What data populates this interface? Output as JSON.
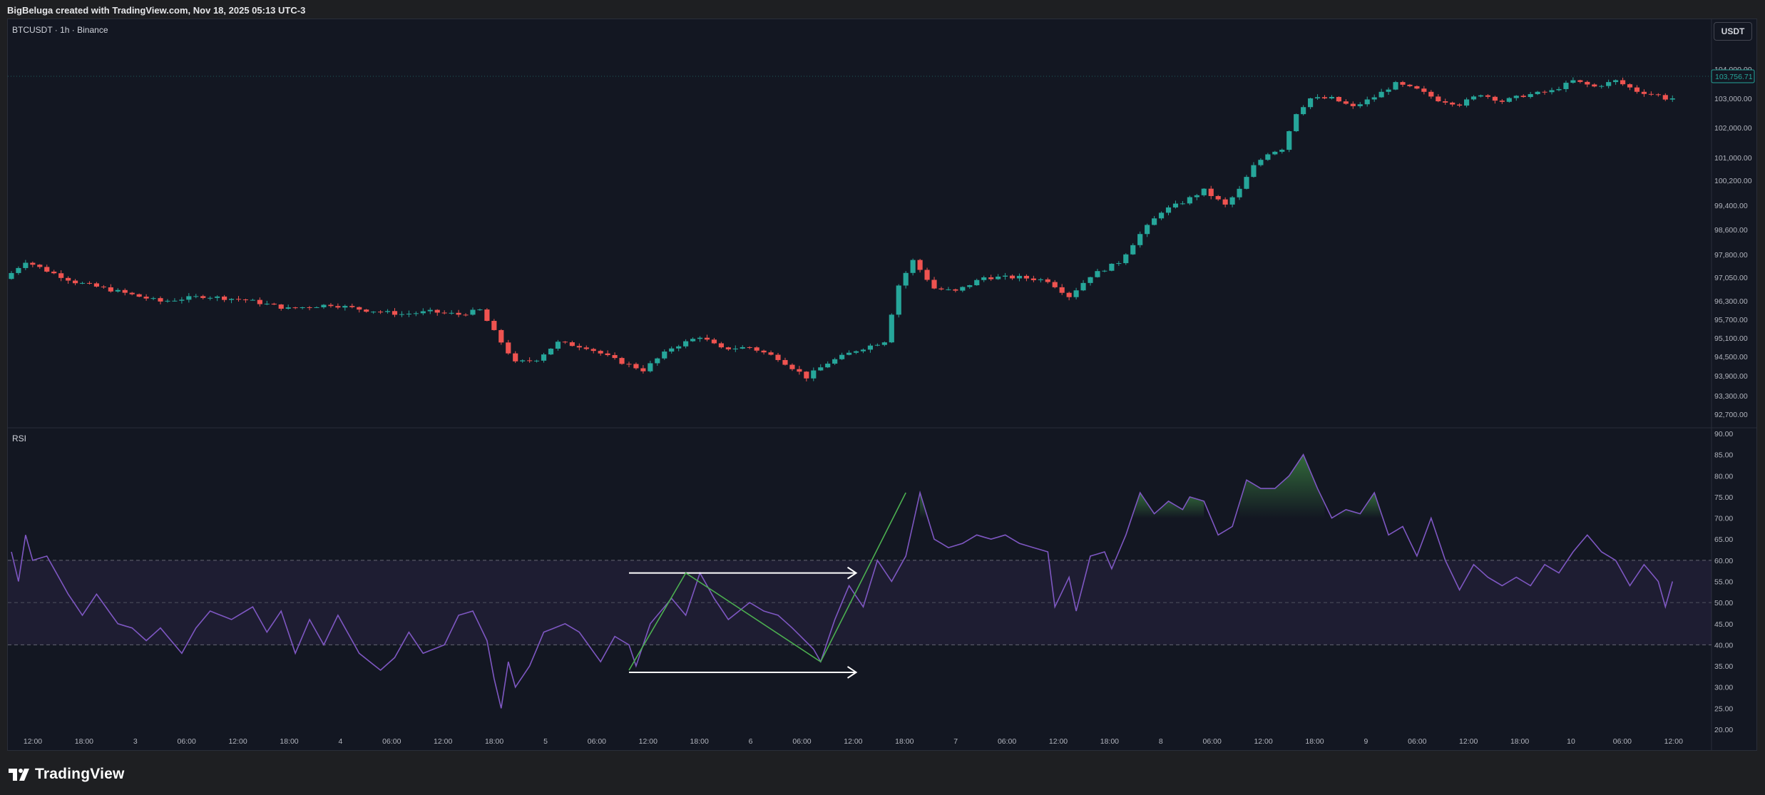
{
  "header": {
    "text": "BigBeluga created with TradingView.com, Nov 18, 2025 05:13 UTC-3"
  },
  "legend": {
    "symbol_text": "BTCUSDT · 1h · Binance"
  },
  "currency_button": {
    "label": "USDT"
  },
  "rsi_panel": {
    "label": "RSI"
  },
  "price_tag": {
    "value": "103,756.71"
  },
  "brand": {
    "name": "TradingView"
  },
  "colors": {
    "up": "#26a69a",
    "down": "#ef5350",
    "rsi": "#7e57c2",
    "arrows": "#ffffff",
    "divergence": "#4caf50",
    "background": "#131722"
  },
  "chart_data": [
    {
      "type": "candlestick",
      "symbol": "BTCUSDT",
      "interval": "1h",
      "exchange": "Binance",
      "ylim": [
        92300,
        104300
      ],
      "y_ticks": [
        "104,000.00",
        "103,000.00",
        "102,000.00",
        "101,000.00",
        "100,200.00",
        "99,400.00",
        "98,600.00",
        "97,800.00",
        "97,050.00",
        "96,300.00",
        "95,700.00",
        "95,100.00",
        "94,500.00",
        "93,900.00",
        "93,300.00",
        "92,700.00"
      ],
      "x_ticks": [
        "12:00",
        "18:00",
        "3",
        "06:00",
        "12:00",
        "18:00",
        "4",
        "06:00",
        "12:00",
        "18:00",
        "5",
        "06:00",
        "12:00",
        "18:00",
        "6",
        "06:00",
        "12:00",
        "18:00",
        "7",
        "06:00",
        "12:00",
        "18:00",
        "8",
        "06:00",
        "12:00",
        "18:00",
        "9",
        "06:00",
        "12:00",
        "18:00",
        "10",
        "06:00",
        "12:00"
      ],
      "waypoints": [
        {
          "i": 0,
          "v": 97000
        },
        {
          "i": 3,
          "v": 97580
        },
        {
          "i": 6,
          "v": 97270
        },
        {
          "i": 10,
          "v": 96900
        },
        {
          "i": 16,
          "v": 96600
        },
        {
          "i": 22,
          "v": 96280
        },
        {
          "i": 28,
          "v": 96450
        },
        {
          "i": 34,
          "v": 96330
        },
        {
          "i": 40,
          "v": 96050
        },
        {
          "i": 46,
          "v": 96180
        },
        {
          "i": 51,
          "v": 96000
        },
        {
          "i": 56,
          "v": 95870
        },
        {
          "i": 60,
          "v": 95950
        },
        {
          "i": 64,
          "v": 95860
        },
        {
          "i": 67,
          "v": 96000
        },
        {
          "i": 69,
          "v": 95300
        },
        {
          "i": 72,
          "v": 94300
        },
        {
          "i": 75,
          "v": 94420
        },
        {
          "i": 78,
          "v": 94950
        },
        {
          "i": 82,
          "v": 94800
        },
        {
          "i": 86,
          "v": 94400
        },
        {
          "i": 90,
          "v": 94080
        },
        {
          "i": 94,
          "v": 94780
        },
        {
          "i": 98,
          "v": 95150
        },
        {
          "i": 101,
          "v": 94750
        },
        {
          "i": 105,
          "v": 94800
        },
        {
          "i": 109,
          "v": 94450
        },
        {
          "i": 113,
          "v": 93860
        },
        {
          "i": 116,
          "v": 94300
        },
        {
          "i": 120,
          "v": 94700
        },
        {
          "i": 124,
          "v": 95000
        },
        {
          "i": 126,
          "v": 96800
        },
        {
          "i": 128,
          "v": 97600
        },
        {
          "i": 131,
          "v": 96700
        },
        {
          "i": 134,
          "v": 96600
        },
        {
          "i": 138,
          "v": 97050
        },
        {
          "i": 143,
          "v": 97050
        },
        {
          "i": 147,
          "v": 96950
        },
        {
          "i": 150,
          "v": 96450
        },
        {
          "i": 153,
          "v": 97100
        },
        {
          "i": 157,
          "v": 97550
        },
        {
          "i": 160,
          "v": 98450
        },
        {
          "i": 163,
          "v": 99200
        },
        {
          "i": 166,
          "v": 99500
        },
        {
          "i": 169,
          "v": 99880
        },
        {
          "i": 172,
          "v": 99400
        },
        {
          "i": 174,
          "v": 99900
        },
        {
          "i": 176,
          "v": 100700
        },
        {
          "i": 178,
          "v": 101150
        },
        {
          "i": 180,
          "v": 101300
        },
        {
          "i": 182,
          "v": 102500
        },
        {
          "i": 184,
          "v": 103000
        },
        {
          "i": 187,
          "v": 103000
        },
        {
          "i": 190,
          "v": 102700
        },
        {
          "i": 193,
          "v": 103050
        },
        {
          "i": 196,
          "v": 103500
        },
        {
          "i": 199,
          "v": 103300
        },
        {
          "i": 202,
          "v": 102950
        },
        {
          "i": 205,
          "v": 102800
        },
        {
          "i": 208,
          "v": 103150
        },
        {
          "i": 211,
          "v": 102900
        },
        {
          "i": 214,
          "v": 103100
        },
        {
          "i": 218,
          "v": 103250
        },
        {
          "i": 221,
          "v": 103600
        },
        {
          "i": 224,
          "v": 103400
        },
        {
          "i": 227,
          "v": 103600
        },
        {
          "i": 230,
          "v": 103250
        },
        {
          "i": 233,
          "v": 103100
        },
        {
          "i": 234,
          "v": 103000
        }
      ],
      "last_price": 103756.71
    },
    {
      "type": "line",
      "name": "RSI",
      "ylim": [
        20,
        90
      ],
      "y_ticks": [
        "90.00",
        "85.00",
        "80.00",
        "75.00",
        "70.00",
        "65.00",
        "60.00",
        "55.00",
        "50.00",
        "45.00",
        "40.00",
        "35.00",
        "30.00",
        "25.00",
        "20.00"
      ],
      "band": [
        40,
        60
      ],
      "midline": 50,
      "waypoints": [
        {
          "i": 0,
          "v": 62
        },
        {
          "i": 1,
          "v": 55
        },
        {
          "i": 2,
          "v": 66
        },
        {
          "i": 3,
          "v": 60
        },
        {
          "i": 5,
          "v": 61
        },
        {
          "i": 8,
          "v": 52
        },
        {
          "i": 10,
          "v": 47
        },
        {
          "i": 12,
          "v": 52
        },
        {
          "i": 15,
          "v": 45
        },
        {
          "i": 17,
          "v": 44
        },
        {
          "i": 19,
          "v": 41
        },
        {
          "i": 21,
          "v": 44
        },
        {
          "i": 24,
          "v": 38
        },
        {
          "i": 26,
          "v": 44
        },
        {
          "i": 28,
          "v": 48
        },
        {
          "i": 31,
          "v": 46
        },
        {
          "i": 34,
          "v": 49
        },
        {
          "i": 36,
          "v": 43
        },
        {
          "i": 38,
          "v": 48
        },
        {
          "i": 40,
          "v": 38
        },
        {
          "i": 42,
          "v": 46
        },
        {
          "i": 44,
          "v": 40
        },
        {
          "i": 46,
          "v": 47
        },
        {
          "i": 49,
          "v": 38
        },
        {
          "i": 52,
          "v": 34
        },
        {
          "i": 54,
          "v": 37
        },
        {
          "i": 56,
          "v": 43
        },
        {
          "i": 58,
          "v": 38
        },
        {
          "i": 61,
          "v": 40
        },
        {
          "i": 63,
          "v": 47
        },
        {
          "i": 65,
          "v": 48
        },
        {
          "i": 67,
          "v": 41
        },
        {
          "i": 68,
          "v": 32
        },
        {
          "i": 69,
          "v": 25
        },
        {
          "i": 70,
          "v": 36
        },
        {
          "i": 71,
          "v": 30
        },
        {
          "i": 73,
          "v": 35
        },
        {
          "i": 75,
          "v": 43
        },
        {
          "i": 78,
          "v": 45
        },
        {
          "i": 80,
          "v": 43
        },
        {
          "i": 83,
          "v": 36
        },
        {
          "i": 85,
          "v": 42
        },
        {
          "i": 87,
          "v": 40
        },
        {
          "i": 88,
          "v": 35
        },
        {
          "i": 90,
          "v": 45
        },
        {
          "i": 93,
          "v": 51
        },
        {
          "i": 95,
          "v": 47
        },
        {
          "i": 97,
          "v": 57
        },
        {
          "i": 99,
          "v": 51
        },
        {
          "i": 101,
          "v": 46
        },
        {
          "i": 104,
          "v": 50
        },
        {
          "i": 106,
          "v": 48
        },
        {
          "i": 108,
          "v": 47
        },
        {
          "i": 110,
          "v": 44
        },
        {
          "i": 113,
          "v": 39
        },
        {
          "i": 114,
          "v": 36
        },
        {
          "i": 116,
          "v": 46
        },
        {
          "i": 118,
          "v": 54
        },
        {
          "i": 120,
          "v": 49
        },
        {
          "i": 122,
          "v": 60
        },
        {
          "i": 124,
          "v": 55
        },
        {
          "i": 126,
          "v": 61
        },
        {
          "i": 128,
          "v": 76
        },
        {
          "i": 130,
          "v": 65
        },
        {
          "i": 132,
          "v": 63
        },
        {
          "i": 134,
          "v": 64
        },
        {
          "i": 136,
          "v": 66
        },
        {
          "i": 138,
          "v": 65
        },
        {
          "i": 140,
          "v": 66
        },
        {
          "i": 142,
          "v": 64
        },
        {
          "i": 144,
          "v": 63
        },
        {
          "i": 146,
          "v": 62
        },
        {
          "i": 147,
          "v": 49
        },
        {
          "i": 149,
          "v": 56
        },
        {
          "i": 150,
          "v": 48
        },
        {
          "i": 152,
          "v": 61
        },
        {
          "i": 154,
          "v": 62
        },
        {
          "i": 155,
          "v": 58
        },
        {
          "i": 157,
          "v": 66
        },
        {
          "i": 159,
          "v": 76
        },
        {
          "i": 161,
          "v": 71
        },
        {
          "i": 163,
          "v": 74
        },
        {
          "i": 165,
          "v": 72
        },
        {
          "i": 166,
          "v": 75
        },
        {
          "i": 168,
          "v": 74
        },
        {
          "i": 170,
          "v": 66
        },
        {
          "i": 172,
          "v": 68
        },
        {
          "i": 174,
          "v": 79
        },
        {
          "i": 176,
          "v": 77
        },
        {
          "i": 178,
          "v": 77
        },
        {
          "i": 180,
          "v": 80
        },
        {
          "i": 182,
          "v": 85
        },
        {
          "i": 184,
          "v": 77
        },
        {
          "i": 186,
          "v": 70
        },
        {
          "i": 188,
          "v": 72
        },
        {
          "i": 190,
          "v": 71
        },
        {
          "i": 192,
          "v": 76
        },
        {
          "i": 194,
          "v": 66
        },
        {
          "i": 196,
          "v": 68
        },
        {
          "i": 198,
          "v": 61
        },
        {
          "i": 200,
          "v": 70
        },
        {
          "i": 202,
          "v": 60
        },
        {
          "i": 204,
          "v": 53
        },
        {
          "i": 206,
          "v": 59
        },
        {
          "i": 208,
          "v": 56
        },
        {
          "i": 210,
          "v": 54
        },
        {
          "i": 212,
          "v": 56
        },
        {
          "i": 214,
          "v": 54
        },
        {
          "i": 216,
          "v": 59
        },
        {
          "i": 218,
          "v": 57
        },
        {
          "i": 220,
          "v": 62
        },
        {
          "i": 222,
          "v": 66
        },
        {
          "i": 224,
          "v": 62
        },
        {
          "i": 226,
          "v": 60
        },
        {
          "i": 228,
          "v": 54
        },
        {
          "i": 230,
          "v": 59
        },
        {
          "i": 232,
          "v": 55
        },
        {
          "i": 233,
          "v": 49
        },
        {
          "i": 234,
          "v": 55
        }
      ],
      "annotations": [
        {
          "kind": "arrow",
          "from": {
            "i": 87,
            "v": 57
          },
          "to": {
            "i": 119,
            "v": 57
          }
        },
        {
          "kind": "arrow",
          "from": {
            "i": 87,
            "v": 33.5
          },
          "to": {
            "i": 119,
            "v": 33.5
          }
        },
        {
          "kind": "divergence-line",
          "points": [
            {
              "i": 87,
              "v": 34
            },
            {
              "i": 95,
              "v": 57
            },
            {
              "i": 114,
              "v": 36
            },
            {
              "i": 126,
              "v": 76
            }
          ]
        }
      ]
    }
  ]
}
